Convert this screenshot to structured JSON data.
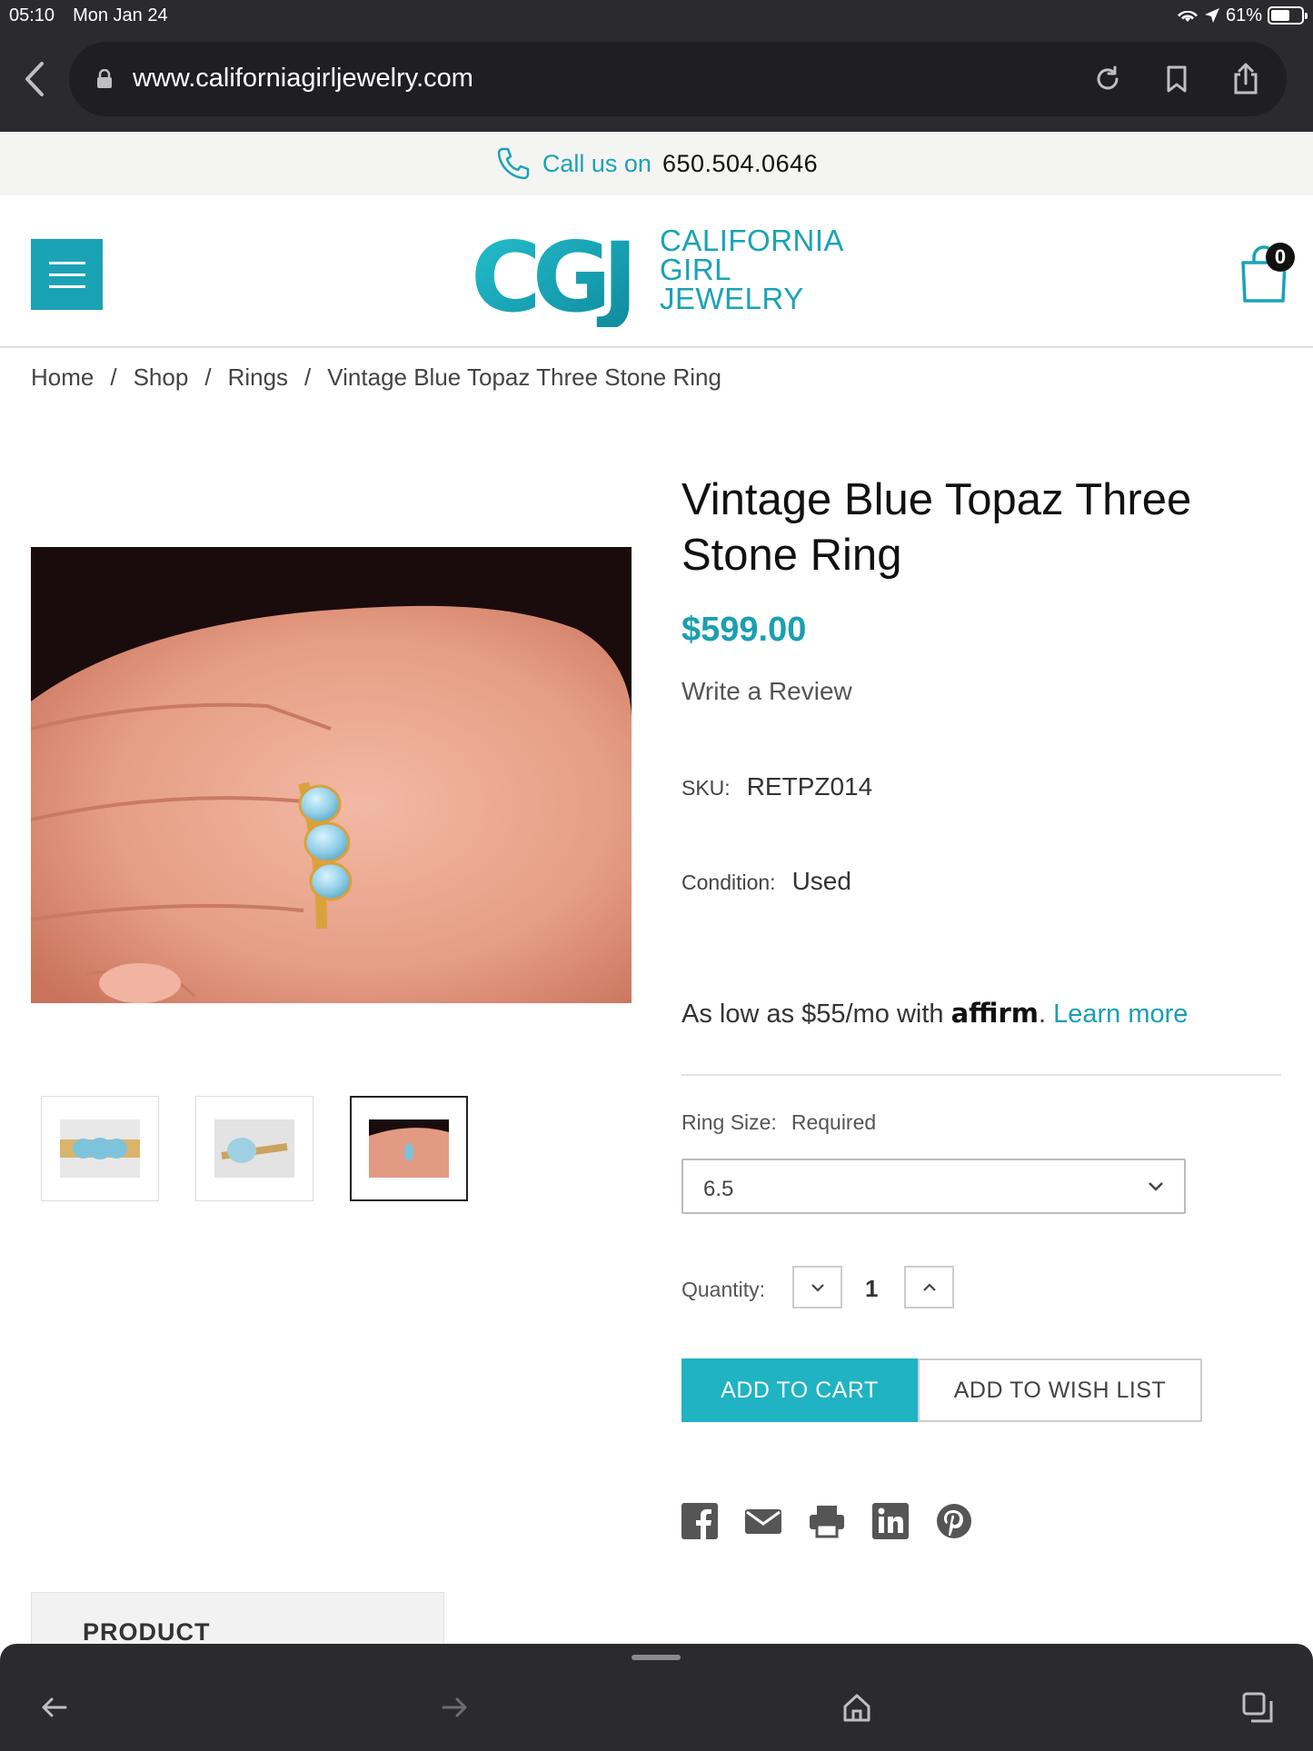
{
  "status": {
    "time": "05:10",
    "date": "Mon Jan 24",
    "battery": "61%",
    "battery_level": 0.61
  },
  "browser": {
    "url": "www.californiagirljewelry.com"
  },
  "callbar": {
    "label": "Call us on",
    "number": "650.504.0646"
  },
  "header": {
    "logo_mark": "CGJ",
    "logo_line1": "CALIFORNIA",
    "logo_line2": "GIRL",
    "logo_line3": "JEWELRY",
    "cart_count": "0"
  },
  "breadcrumb": [
    "Home",
    "Shop",
    "Rings",
    "Vintage Blue Topaz Three Stone Ring"
  ],
  "product": {
    "title": "Vintage Blue Topaz Three Stone Ring",
    "price": "$599.00",
    "review_link": "Write a Review",
    "sku_label": "SKU:",
    "sku": "RETPZ014",
    "condition_label": "Condition:",
    "condition": "Used",
    "affirm_prefix": "As low as $55/mo with",
    "affirm_brand": "affirm",
    "affirm_dot": ".",
    "affirm_link": "Learn more",
    "ring_size_label": "Ring Size:",
    "ring_size_required": "Required",
    "ring_size_value": "6.5",
    "quantity_label": "Quantity:",
    "quantity": "1",
    "add_to_cart": "ADD TO CART",
    "add_to_wishlist": "ADD TO WISH LIST",
    "description_tab": "PRODUCT DESCRIPTION"
  },
  "colors": {
    "brand": "#1aa3b5",
    "chrome": "#2b2b2d"
  }
}
